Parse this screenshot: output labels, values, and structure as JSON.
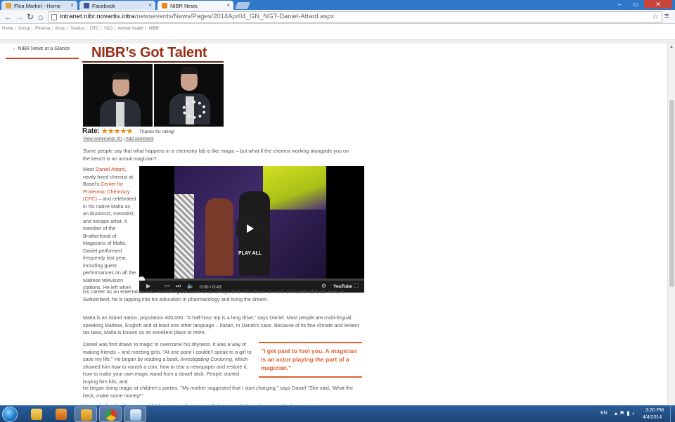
{
  "browser": {
    "tabs": [
      {
        "label": "Flea Market - Home",
        "active": false,
        "favicon_color": "#e8a13a"
      },
      {
        "label": "Facebook",
        "active": false,
        "favicon_color": "#3b5998"
      },
      {
        "label": "NIBR News",
        "active": true,
        "favicon_color": "#e58a13"
      }
    ],
    "url_host": "intranet.nibr.novartis.intra",
    "url_path": "/newsevents/News/Pages/2014Apr04_GN_NGT-Daniel-Attard.aspx"
  },
  "sitenav": {
    "items": [
      "Home",
      "Group",
      "Pharma",
      "Alcon",
      "Sandoz",
      "OTC",
      "V&D",
      "Animal Health",
      "NIBR"
    ]
  },
  "leftnav": {
    "item": "NIBR News at a Glance"
  },
  "article": {
    "title": "NIBR’s Got Talent",
    "rate_label": "Rate:",
    "stars": "★★★★★",
    "rating_value": 5,
    "rating_max": 5,
    "thanks": "Thanks for rating!",
    "view_comments": "View comments (0)",
    "comments_sep": " | ",
    "add_comment": "Add comment",
    "intro": "Some people say that what happens in a chemistry lab is like magic – but what if the chemist working alongside you on the bench is an actual magician?",
    "meet_prefix": "Meet ",
    "meet_name": "Daniel Attard",
    "meet_mid": ", newly hired chemist at Basel’s ",
    "meet_link": "Center for Proteomic Chemistry (CPC)",
    "meet_rest": " – and celebrated in his native Malta as an illusionist, mentalist, and escape artist. A member of the Brotherhood of Magicians of Malta, Daniel performed frequently last year, including guest performances on all the Maltese television stations. He left when",
    "meet_cont": "his career as an entertainer was flourishing because it has always been his dream to work and travel abroad. Now, in Switzerland, he is tapping into his education in pharmacology and living the dream.",
    "malta": "Malta is an island nation, population 400,000. \"A half-hour trip is a long drive,\" says Daniel. Most people are multi-lingual, speaking Maltese, English and at least one other language – Italian, in Daniel’s case. Because of its fine climate and lenient tax laws, Malta is known as an excellent place to retire.",
    "daniel_1": "Daniel was first drawn to magic to overcome his shyness. It was a way of making friends – and meeting girls. \"At one point I couldn't speak to a girl to save my life.\" He began by reading a book, ",
    "daniel_book": "Investigating Conjuring",
    "daniel_2": ", which showed him how to vanish a coin, how to tear a newspaper and restore it, how to make your own magic wand from a dowel stick. People started buying him kits, and",
    "daniel_cont": "he began doing magic at children’s parties. \"My mother suggested that I start charging,\" says Daniel.\"She said, 'What the heck, make some money!'\"",
    "studied": "He studied at the University of Malta, eventually getting a B.A. and an M.A. in pharmacy. \"A pharmacist is very",
    "quote": "\"I get paid to fool you. A magician is an actor playing the part of a magician.\""
  },
  "video": {
    "play_all": "PLAY ALL",
    "time": "0:00 / 0:43",
    "brand": "YouTube"
  },
  "taskbar": {
    "lang": "EN",
    "time": "3:20 PM",
    "date": "4/4/2014"
  },
  "colors": {
    "accent": "#c8451e",
    "title": "#9b2d15",
    "quote": "#e0602c"
  }
}
